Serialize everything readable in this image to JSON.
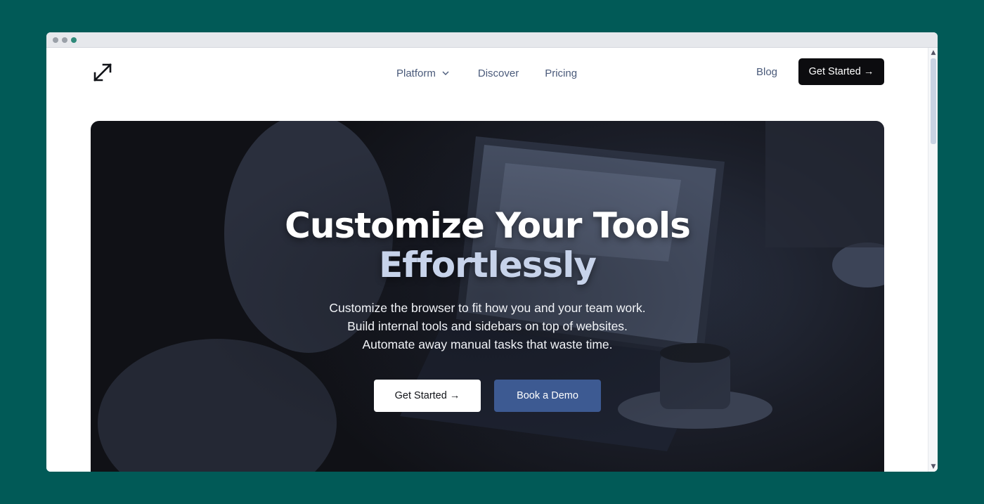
{
  "nav": {
    "platform_label": "Platform",
    "discover_label": "Discover",
    "pricing_label": "Pricing",
    "blog_label": "Blog",
    "cta_label": "Get Started →"
  },
  "hero": {
    "title_line1": "Customize Your Tools",
    "title_line2": "Effortlessly",
    "subtitle_lines": [
      "Customize the browser to fit how you and your team work.",
      "Build internal tools and sidebars on top of websites.",
      "Automate away manual tasks that waste time."
    ],
    "primary_button_label": "Get Started →",
    "secondary_button_label": "Book a Demo"
  },
  "colors": {
    "page_background": "#015a57",
    "hero_title_accent": "#c7d3ea",
    "demo_button": "#3d5a92",
    "nav_cta_background": "#0c0c0f",
    "nav_link": "#4a5a7a"
  },
  "icons": {
    "logo": "expand-arrows-icon",
    "platform_dropdown": "chevron-down-icon",
    "scroll_up": "chevron-up-icon",
    "scroll_down": "chevron-down-icon"
  }
}
